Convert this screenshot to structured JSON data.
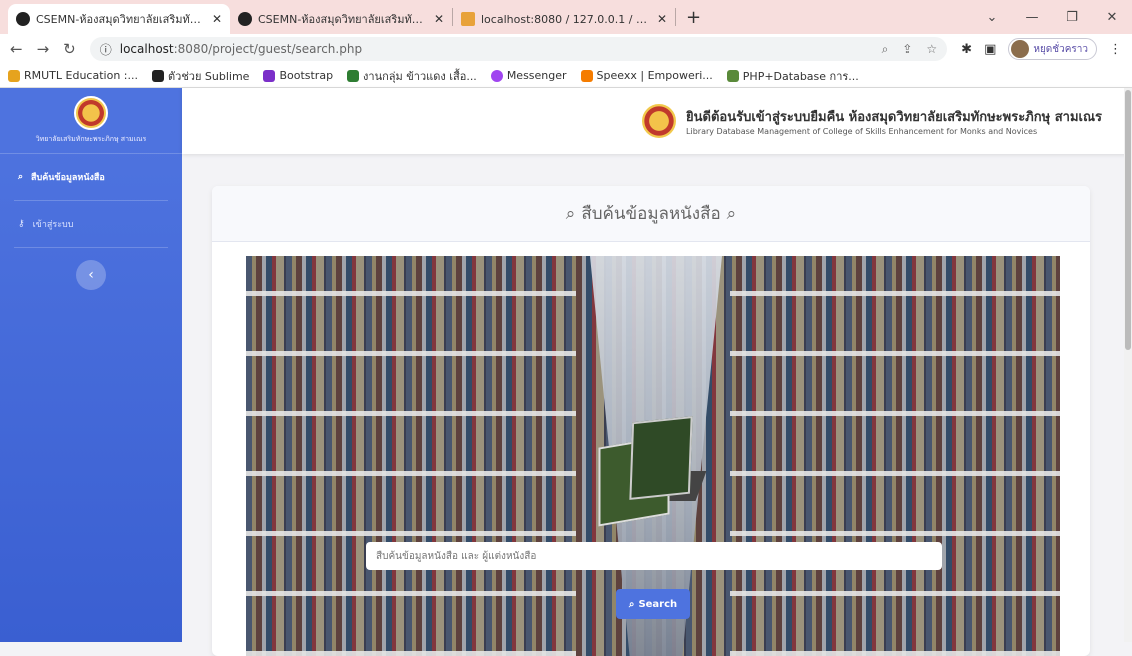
{
  "tabs": [
    {
      "label": "CSEMN-ห้องสมุดวิทยาลัยเสริมทักษ..."
    },
    {
      "label": "CSEMN-ห้องสมุดวิทยาลัยเสริมทักษ..."
    },
    {
      "label": "localhost:8080 / 127.0.0.1 / csem"
    }
  ],
  "address": {
    "host": "localhost",
    "path": ":8080/project/guest/search.php"
  },
  "profile": {
    "label": "หยุดชั่วคราว"
  },
  "bookmarks": [
    {
      "label": "RMUTL Education :...",
      "color": "#e6a31e"
    },
    {
      "label": "ตัวช่วย Sublime",
      "color": "#222"
    },
    {
      "label": "Bootstrap",
      "color": "#7b2fc9"
    },
    {
      "label": "งานกลุ่ม ข้าวแดง เสื้อ...",
      "color": "#2e7d32"
    },
    {
      "label": "Messenger",
      "color": "#a045f0"
    },
    {
      "label": "Speexx | Empoweri...",
      "color": "#f57c00"
    },
    {
      "label": "PHP+Database การ...",
      "color": "#5a8a3a"
    }
  ],
  "sidebar": {
    "brand_text": "วิทยาลัยเสริมทักษะพระภิกษุ สามเณร",
    "items": [
      {
        "label": "สืบค้นข้อมูลหนังสือ"
      },
      {
        "label": "เข้าสู่ระบบ"
      }
    ]
  },
  "header": {
    "title": "ยินดีต้อนรับเข้าสู่ระบบยืมคืน ห้องสมุดวิทยาลัยเสริมทักษะพระภิกษุ สามเณร",
    "subtitle": "Library Database Management of College of Skills Enhancement for Monks and Novices"
  },
  "card": {
    "title": "สืบค้นข้อมูลหนังสือ"
  },
  "search": {
    "placeholder": "สืบค้นข้อมูลหนังสือ และ ผู้แต่งหนังสือ",
    "button": "Search"
  }
}
